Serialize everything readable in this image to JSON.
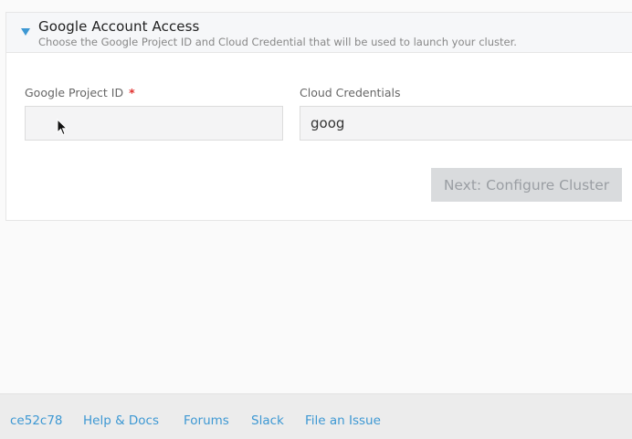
{
  "section": {
    "title": "Google Account Access",
    "subtitle": "Choose the Google Project ID and Cloud Credential that will be used to launch your cluster."
  },
  "form": {
    "project_id_label": "Google Project ID",
    "project_id_required": "*",
    "project_id_value": "",
    "credentials_label": "Cloud Credentials",
    "credentials_value": "goog"
  },
  "actions": {
    "next_label": "Next: Configure Cluster"
  },
  "footer": {
    "version": "ce52c78",
    "help": "Help & Docs",
    "forums": "Forums",
    "slack": "Slack",
    "issue": "File an Issue"
  },
  "colors": {
    "accent": "#3d98d3",
    "required": "#e0322f",
    "disabled_button_bg": "#d9dbdd"
  },
  "icons": {
    "chevron": "chevron-down-icon",
    "cursor": "mouse-pointer-icon"
  }
}
